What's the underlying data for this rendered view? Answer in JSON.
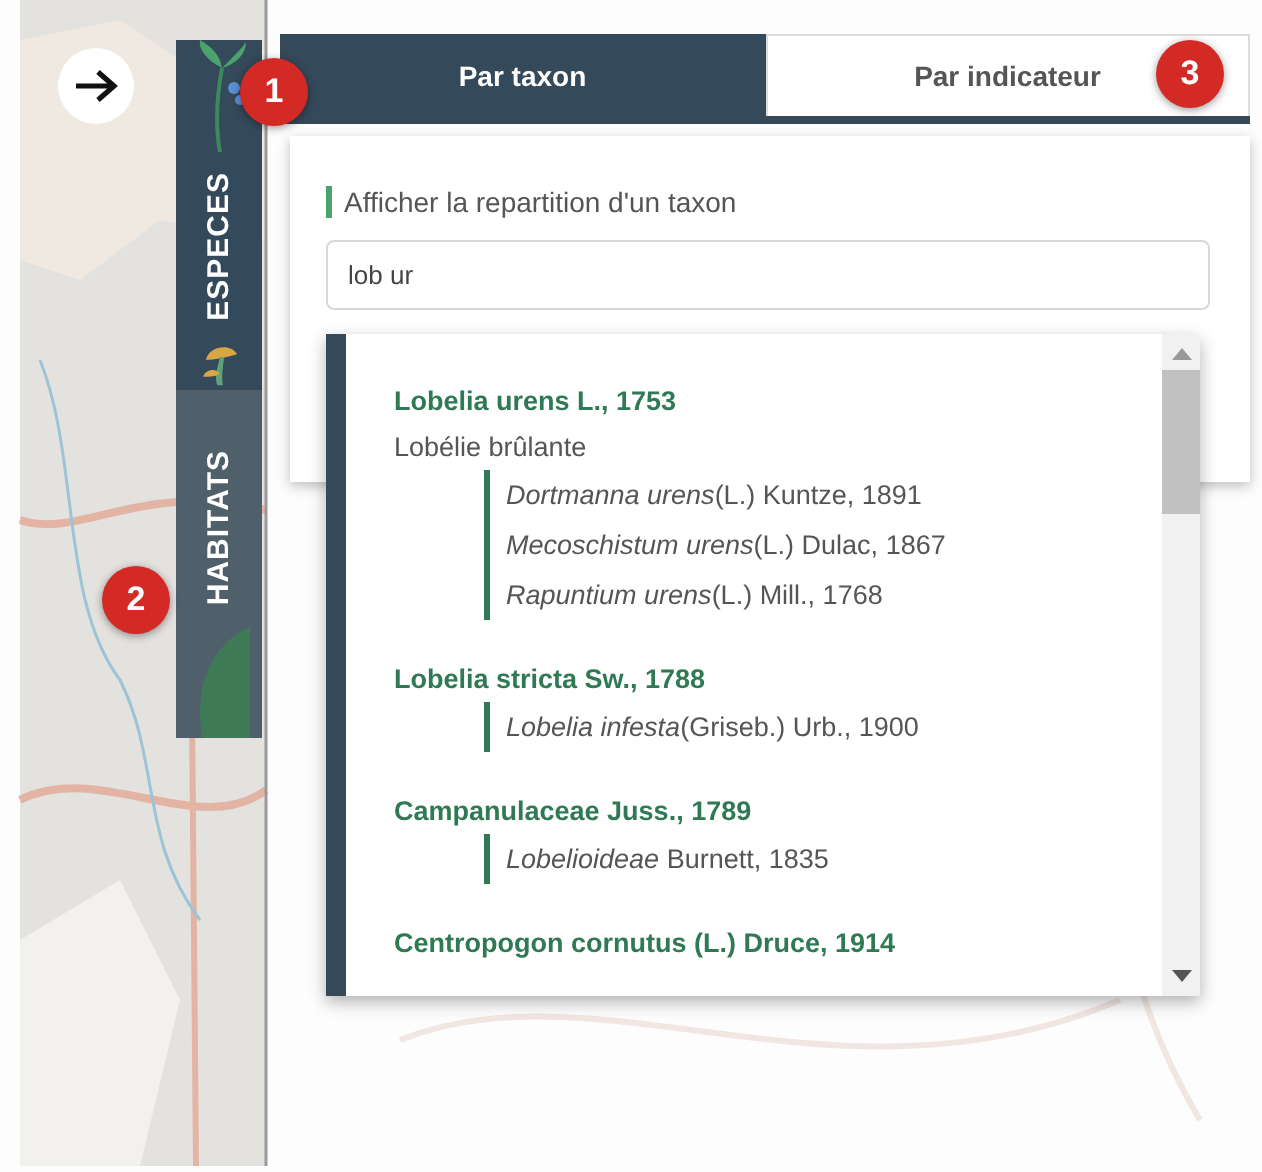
{
  "side_tabs": [
    {
      "label": "ESPECES",
      "selected": true
    },
    {
      "label": "HABITATS",
      "selected": false
    }
  ],
  "badges": [
    "1",
    "2",
    "3"
  ],
  "tabs": [
    {
      "label": "Par taxon",
      "selected": true
    },
    {
      "label": "Par indicateur",
      "selected": false
    }
  ],
  "search": {
    "label": "Afficher la repartition d'un taxon",
    "value": "lob ur"
  },
  "results": [
    {
      "name": "Lobelia urens L., 1753",
      "vernacular": "Lobélie brûlante",
      "synonyms": [
        "*Dortmanna urens*(L.) Kuntze, 1891",
        "*Mecoschistum urens*(L.) Dulac, 1867",
        "*Rapuntium urens*(L.) Mill., 1768"
      ]
    },
    {
      "name": "Lobelia stricta Sw., 1788",
      "synonyms": [
        "*Lobelia infesta*(Griseb.) Urb., 1900"
      ]
    },
    {
      "name": "Campanulaceae Juss., 1789",
      "synonyms": [
        "*Lobelioideae* Burnett, 1835"
      ]
    },
    {
      "name": "Centropogon cornutus (L.) Druce, 1914"
    }
  ]
}
